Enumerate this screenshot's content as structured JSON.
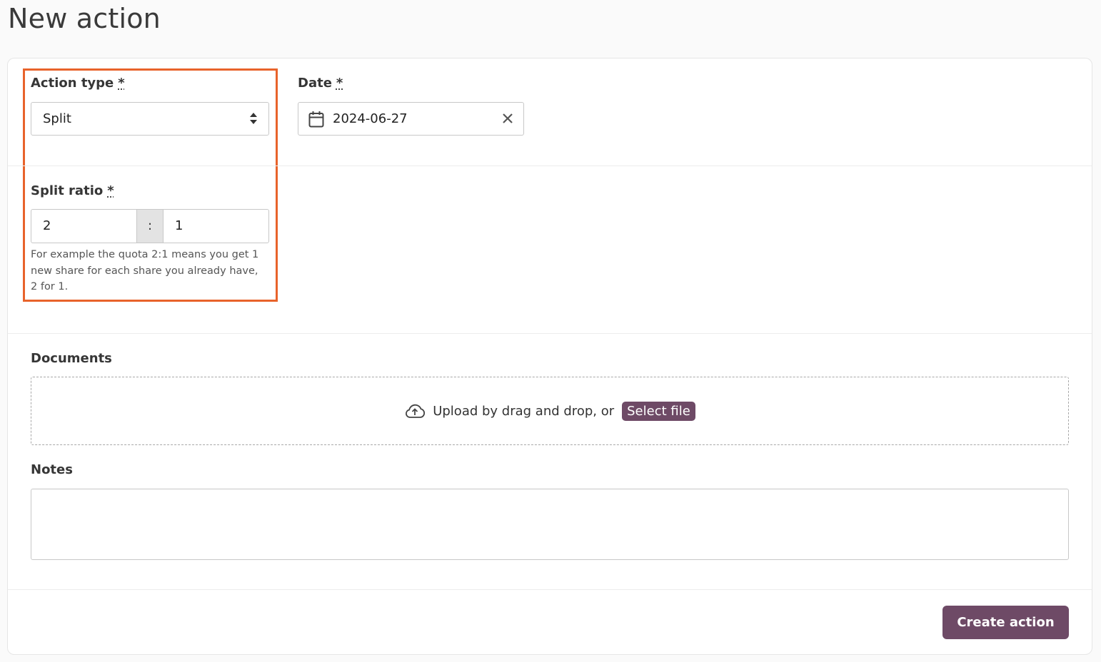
{
  "page": {
    "title": "New action"
  },
  "form": {
    "action_type": {
      "label": "Action type",
      "required_mark": "*",
      "value": "Split"
    },
    "date": {
      "label": "Date",
      "required_mark": "*",
      "value": "2024-06-27"
    },
    "split_ratio": {
      "label": "Split ratio",
      "required_mark": "*",
      "left_value": "2",
      "separator": ":",
      "right_value": "1",
      "help_text": "For example the quota 2:1 means you get 1 new share for each share you already have, 2 for 1."
    },
    "documents": {
      "label": "Documents",
      "upload_text": "Upload by drag and drop, or",
      "select_file_label": "Select file"
    },
    "notes": {
      "label": "Notes",
      "value": ""
    },
    "submit_label": "Create action"
  },
  "colors": {
    "accent": "#6e4a66",
    "highlight": "#e8632b"
  },
  "icons": {
    "select_arrows": "sort-arrows-icon",
    "calendar": "calendar-icon",
    "clear": "close-icon",
    "upload": "cloud-upload-icon"
  }
}
